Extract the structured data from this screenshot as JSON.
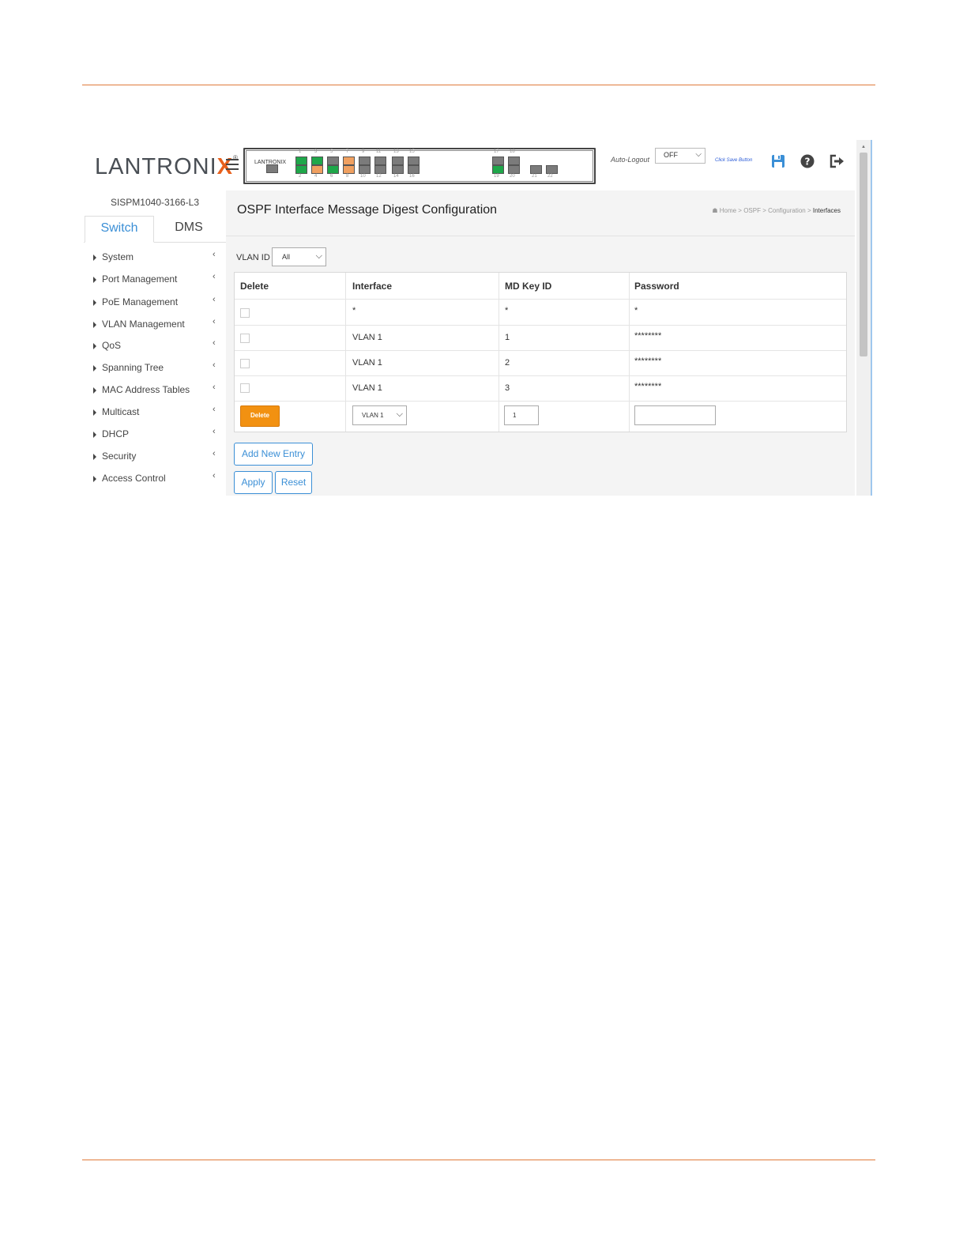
{
  "header": {
    "logo_text": "LANTRONIX",
    "logo_mark": "®",
    "mini_logo": "LANTRONIX",
    "auto_logout_label": "Auto-Logout",
    "auto_logout_value": "OFF",
    "save_hint": "Click Save Button",
    "ports_top": [
      "1",
      "3",
      "5",
      "7",
      "9",
      "11",
      "13",
      "15",
      "17",
      "18"
    ],
    "ports_bottom": [
      "2",
      "4",
      "6",
      "8",
      "10",
      "12",
      "14",
      "16",
      "19",
      "20",
      "21",
      "22"
    ]
  },
  "sidebar": {
    "model": "SISPM1040-3166-L3",
    "tabs": [
      "Switch",
      "DMS"
    ],
    "items": [
      {
        "label": "System"
      },
      {
        "label": "Port Management"
      },
      {
        "label": "PoE Management"
      },
      {
        "label": "VLAN Management"
      },
      {
        "label": "QoS"
      },
      {
        "label": "Spanning Tree"
      },
      {
        "label": "MAC Address Tables"
      },
      {
        "label": "Multicast"
      },
      {
        "label": "DHCP"
      },
      {
        "label": "Security"
      },
      {
        "label": "Access Control"
      }
    ]
  },
  "main": {
    "title": "OSPF Interface Message Digest Configuration",
    "breadcrumb": {
      "home": "Home",
      "sep": ">",
      "items": [
        "OSPF",
        "Configuration"
      ],
      "current": "Interfaces"
    },
    "vlan_filter": {
      "label": "VLAN ID",
      "value": "All"
    },
    "table": {
      "headers": [
        "Delete",
        "Interface",
        "MD Key ID",
        "Password"
      ],
      "rows": [
        {
          "interface": "*",
          "key_id": "*",
          "password": "*"
        },
        {
          "interface": "VLAN 1",
          "key_id": "1",
          "password": "********"
        },
        {
          "interface": "VLAN 1",
          "key_id": "2",
          "password": "********"
        },
        {
          "interface": "VLAN 1",
          "key_id": "3",
          "password": "********"
        }
      ],
      "new_row": {
        "delete_label": "Delete",
        "interface_value": "VLAN 1",
        "key_id_value": "1",
        "password_value": ""
      }
    },
    "buttons": {
      "add": "Add New Entry",
      "apply": "Apply",
      "reset": "Reset"
    }
  },
  "colors": {
    "accent": "#3b8fd6",
    "brand": "#e8601c",
    "delete": "#f29111",
    "rule": "#e07a3a",
    "port_green": "#1fa74a",
    "port_orange": "#f0a060"
  }
}
